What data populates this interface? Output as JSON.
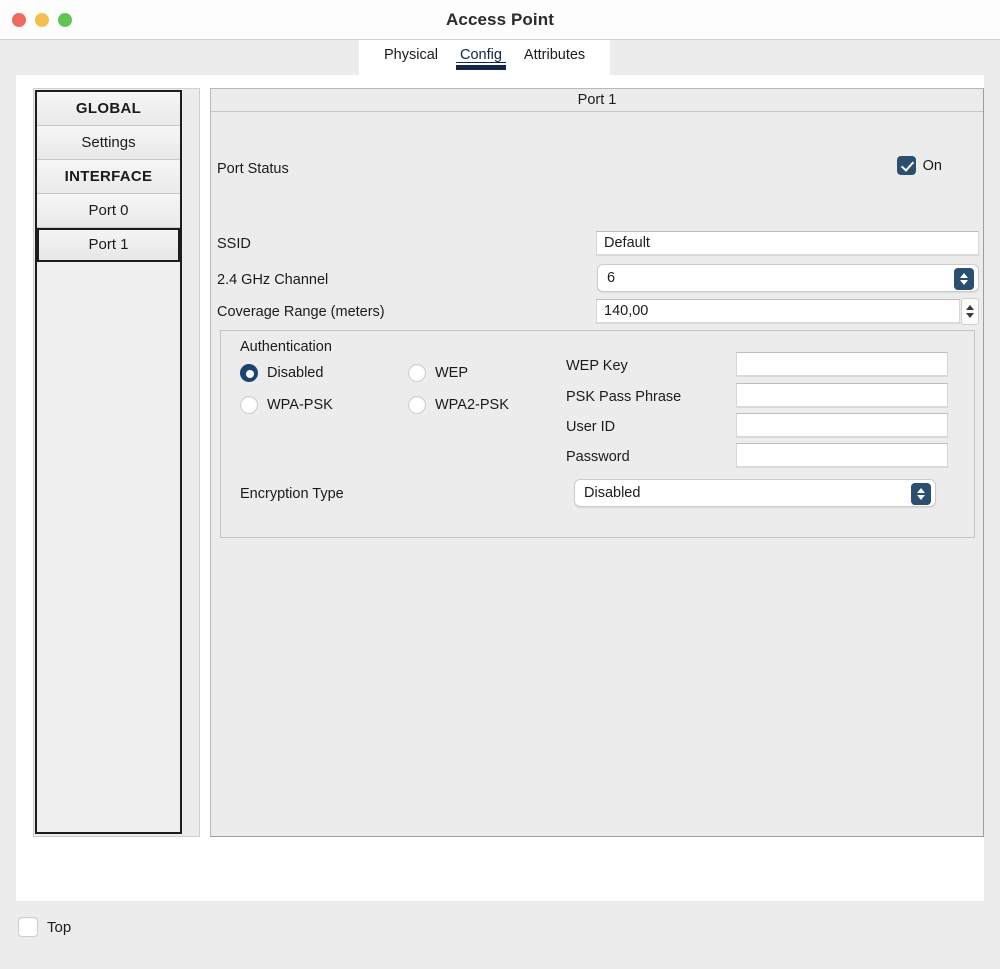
{
  "window": {
    "title": "Access Point",
    "controls": [
      "close",
      "minimize",
      "maximize"
    ]
  },
  "tabs": [
    {
      "label": "Physical",
      "active": false
    },
    {
      "label": "Config",
      "active": true
    },
    {
      "label": "Attributes",
      "active": false
    }
  ],
  "sidebar": {
    "items": [
      {
        "label": "GLOBAL",
        "type": "header",
        "selected": false
      },
      {
        "label": "Settings",
        "type": "item",
        "selected": false
      },
      {
        "label": "INTERFACE",
        "type": "header",
        "selected": false
      },
      {
        "label": "Port 0",
        "type": "item",
        "selected": false
      },
      {
        "label": "Port 1",
        "type": "item",
        "selected": true
      }
    ]
  },
  "panel": {
    "header": "Port 1",
    "port_status": {
      "label": "Port Status",
      "checkbox_label": "On",
      "checked": true
    },
    "ssid": {
      "label": "SSID",
      "value": "Default"
    },
    "channel": {
      "label": "2.4 GHz Channel",
      "value": "6"
    },
    "coverage": {
      "label": "Coverage Range (meters)",
      "value": "140,00"
    },
    "authentication": {
      "title": "Authentication",
      "options": [
        {
          "label": "Disabled",
          "selected": true
        },
        {
          "label": "WEP",
          "selected": false
        },
        {
          "label": "WPA-PSK",
          "selected": false
        },
        {
          "label": "WPA2-PSK",
          "selected": false
        }
      ],
      "fields": [
        {
          "label": "WEP Key",
          "value": ""
        },
        {
          "label": "PSK Pass Phrase",
          "value": ""
        },
        {
          "label": "User ID",
          "value": ""
        },
        {
          "label": "Password",
          "value": ""
        }
      ],
      "encryption": {
        "label": "Encryption Type",
        "value": "Disabled"
      }
    }
  },
  "bottom": {
    "top_checkbox": {
      "label": "Top",
      "checked": false
    }
  },
  "colors": {
    "accent": "#13284c",
    "control_blue": "#2b4f70",
    "radio_on": "#1d4470",
    "window_bg": "#ececec",
    "content_bg": "#ffffff",
    "close": "#ec6a5e",
    "minimize": "#f4bf4f",
    "maximize": "#61c554"
  }
}
